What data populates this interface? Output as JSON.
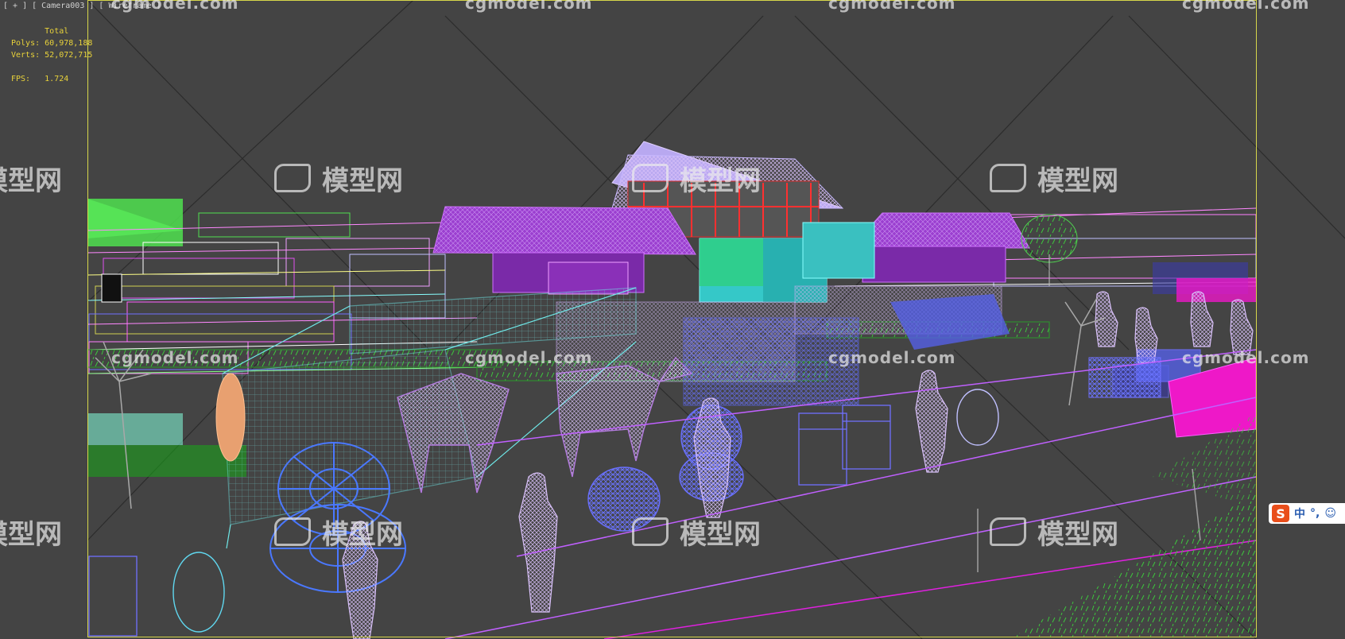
{
  "viewport": {
    "label": "[ + ] [ Camera003 ] [ Wireframe ]"
  },
  "stats": {
    "header": "Total",
    "polys_label": "Polys:",
    "polys_value": "60,978,188",
    "verts_label": "Verts:",
    "verts_value": "52,072,715",
    "fps_label": "FPS:",
    "fps_value": "1.724"
  },
  "watermark": {
    "site": "cgmodel.com",
    "logo": "模型网"
  },
  "ime_bar": {
    "icon": "S",
    "mode": "中",
    "punct": "°,",
    "emoji": "☺"
  },
  "colors": {
    "background": "#444444",
    "frame": "#d6d64a",
    "stats_text": "#e8d23a",
    "purple": "#a64bd6",
    "lavender": "#c8a8f0",
    "cyan": "#4fd8d8",
    "blue": "#5560e6",
    "green": "#40d040",
    "magenta": "#ee18c8"
  }
}
